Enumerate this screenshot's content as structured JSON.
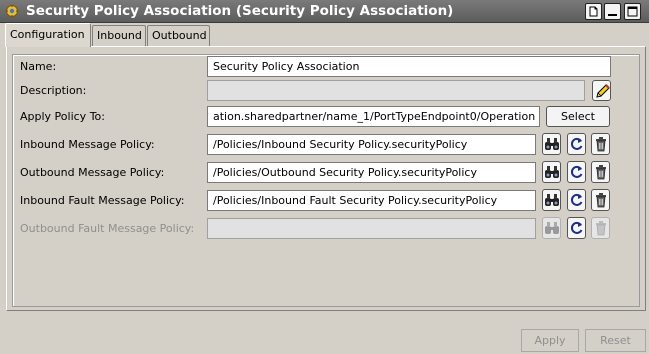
{
  "window": {
    "title": "Security Policy Association (Security Policy Association)"
  },
  "tabs": [
    {
      "label": "Configuration",
      "active": true
    },
    {
      "label": "Inbound",
      "active": false
    },
    {
      "label": "Outbound",
      "active": false
    }
  ],
  "form": {
    "name": {
      "label": "Name:",
      "value": "Security Policy Association"
    },
    "description": {
      "label": "Description:",
      "value": ""
    },
    "apply_policy_to": {
      "label": "Apply Policy To:",
      "value": "ation.sharedpartner/name_1/PortTypeEndpoint0/Operation",
      "button_label": "Select"
    },
    "inbound_message_policy": {
      "label": "Inbound Message Policy:",
      "value": "/Policies/Inbound Security Policy.securityPolicy"
    },
    "outbound_message_policy": {
      "label": "Outbound Message Policy:",
      "value": "/Policies/Outbound Security Policy.securityPolicy"
    },
    "inbound_fault_message_policy": {
      "label": "Inbound Fault Message Policy:",
      "value": "/Policies/Inbound Fault Security Policy.securityPolicy"
    },
    "outbound_fault_message_policy": {
      "label": "Outbound Fault Message Policy:",
      "value": ""
    }
  },
  "footer": {
    "apply_label": "Apply",
    "reset_label": "Reset"
  },
  "icons": {
    "browse": "binoculars-icon",
    "goto": "goto-resource-icon",
    "delete": "trash-icon",
    "edit": "pencil-icon"
  }
}
